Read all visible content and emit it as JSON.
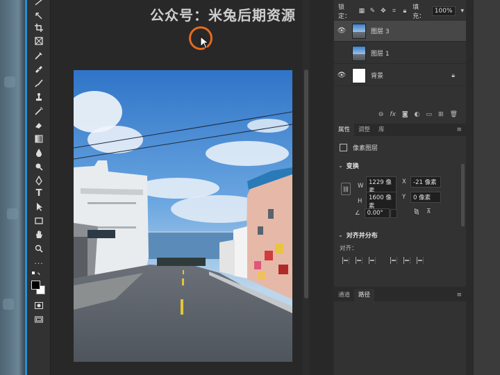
{
  "watermark": "公众号：米兔后期资源",
  "toolbar": {
    "tools": [
      "move-icon",
      "marquee-icon",
      "lasso-icon",
      "crop-icon",
      "frame-icon",
      "eyedropper-icon",
      "healing-icon",
      "brush-icon",
      "stamp-icon",
      "history-brush-icon",
      "eraser-icon",
      "gradient-icon",
      "blur-icon",
      "dodge-icon",
      "pen-icon",
      "type-icon",
      "path-select-icon",
      "shape-icon",
      "hand-icon",
      "zoom-icon",
      "more-icon",
      "colors-icon",
      "quickmask-icon",
      "screenmode-icon"
    ]
  },
  "layers": {
    "lock_label": "锁定：",
    "fill_label": "填充：",
    "fill_value": "100%",
    "items": [
      {
        "name": "图层 3",
        "visible": true,
        "selected": true
      },
      {
        "name": "图层 1",
        "visible": false,
        "selected": false
      },
      {
        "name": "背景",
        "visible": true,
        "selected": false,
        "locked": true
      }
    ],
    "footer_fx": "fx"
  },
  "properties": {
    "tabs": [
      "属性",
      "调整",
      "库"
    ],
    "active_tab": "属性",
    "layer_type": "像素图层",
    "transform_title": "变换",
    "w_label": "W",
    "w_value": "1229 像素",
    "x_label": "X",
    "x_value": "-21 像素",
    "h_label": "H",
    "h_value": "1600 像素",
    "y_label": "Y",
    "y_value": "0 像素",
    "angle_value": "0.00°",
    "align_title": "对齐并分布",
    "align_label": "对齐："
  },
  "bottom_panel": {
    "tabs": [
      "通道",
      "路径"
    ],
    "active_tab": "路径"
  },
  "colors": {
    "accent": "#2b8fd6",
    "cursor_ring": "#e86a1f",
    "panel_bg": "#323232",
    "canvas_bg": "#282828"
  }
}
